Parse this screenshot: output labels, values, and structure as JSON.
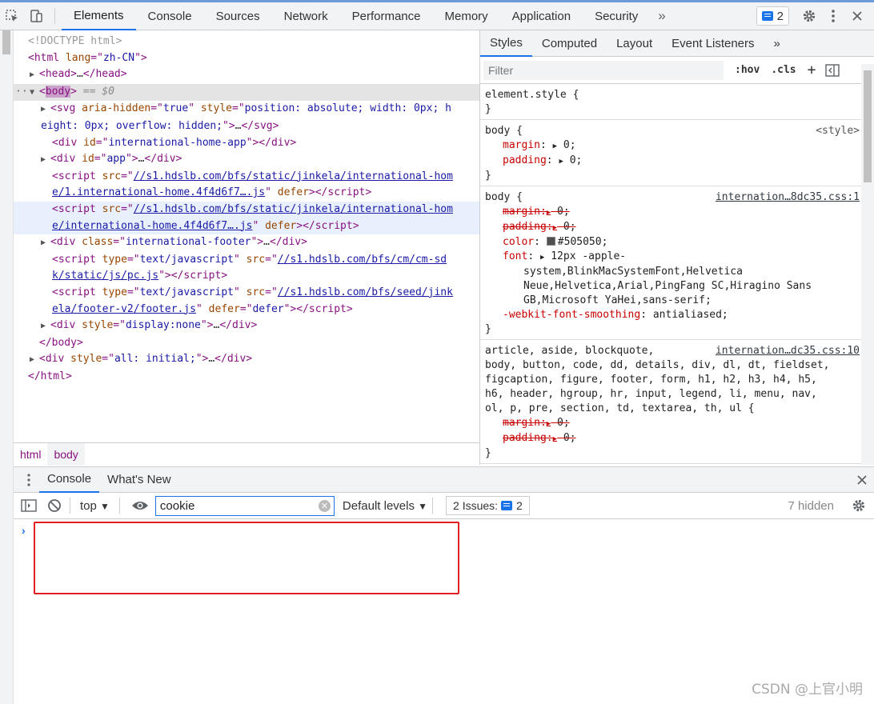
{
  "toolbar": {
    "tabs": [
      "Elements",
      "Console",
      "Sources",
      "Network",
      "Performance",
      "Memory",
      "Application",
      "Security"
    ],
    "more": "»",
    "issues_count": "2"
  },
  "elements_tree": {
    "doctype": "<!DOCTYPE html>",
    "html_open_tag": "html",
    "html_lang_attr": "lang",
    "html_lang_val": "zh-CN",
    "head": "head",
    "ellipsis": "…",
    "body_tag": "body",
    "selected_marker": "== $0",
    "svg_line1_a": "svg",
    "svg_attr1": "aria-hidden",
    "svg_val1": "true",
    "svg_attr2": "style",
    "svg_val2a": "position: absolute; width: 0px; h",
    "svg_val2b": "eight: 0px; overflow: hidden;",
    "div1_id": "international-home-app",
    "div2_id": "app",
    "script1_src_a": "//s1.hdslb.com/bfs/static/jinkela/international-hom",
    "script1_src_b": "e/1.international-home.4f4d6f7….js",
    "script2_src_a": "//s1.hdslb.com/bfs/static/jinkela/international-hom",
    "script2_src_b": "e/international-home.4f4d6f7….js",
    "defer": "defer",
    "footer_class": "international-footer",
    "script3_type": "text/javascript",
    "script3_src_a": "//s1.hdslb.com/bfs/cm/cm-sd",
    "script3_src_b": "k/static/js/pc.js",
    "script4_src_a": "//s1.hdslb.com/bfs/seed/jink",
    "script4_src_b": "ela/footer-v2/footer.js",
    "script4_defer_val": "defer",
    "div_style_none": "display:none",
    "div_style_all": "all: initial;"
  },
  "breadcrumbs": [
    "html",
    "body"
  ],
  "styles": {
    "tabs": [
      "Styles",
      "Computed",
      "Layout",
      "Event Listeners"
    ],
    "more": "»",
    "filter_placeholder": "Filter",
    "hov": ":hov",
    "cls": ".cls",
    "rules": {
      "element_style": "element.style {",
      "close": "}",
      "body_sel": "body {",
      "source_style": "<style>",
      "source_css1": "internation…8dc35.css:1",
      "source_css2": "internation…dc35.css:10",
      "margin": "margin",
      "padding": "padding",
      "zero": "0;",
      "color": "color",
      "color_val": "#505050;",
      "font": "font",
      "font_val1": "12px -apple-",
      "font_val2": "system,BlinkMacSystemFont,Helvetica",
      "font_val3": "Neue,Helvetica,Arial,PingFang SC,Hiragino Sans",
      "font_val4": "GB,Microsoft YaHei,sans-serif;",
      "smoothing": "-webkit-font-smoothing",
      "smoothing_val": "antialiased;",
      "reset_sel1": "article, aside, blockquote,",
      "reset_sel2": "body, button, code, dd, details, div, dl, dt, fieldset,",
      "reset_sel3": "figcaption, figure, footer, form, h1, h2, h3, h4, h5,",
      "reset_sel4": "h6, header, hgroup, hr, input, legend, li, menu, nav,",
      "reset_sel5": "ol, p, pre, section, td, textarea, th, ul {"
    }
  },
  "drawer": {
    "tabs": [
      "Console",
      "What's New"
    ],
    "context": "top",
    "search_value": "cookie",
    "levels": "Default levels",
    "issues_label": "2 Issues:",
    "issues_count": "2",
    "hidden": "7 hidden",
    "prompt": "›"
  },
  "watermark": "CSDN @上官小明",
  "colors": {
    "accent": "#1a73e8",
    "highlight_box": "#e02020"
  }
}
